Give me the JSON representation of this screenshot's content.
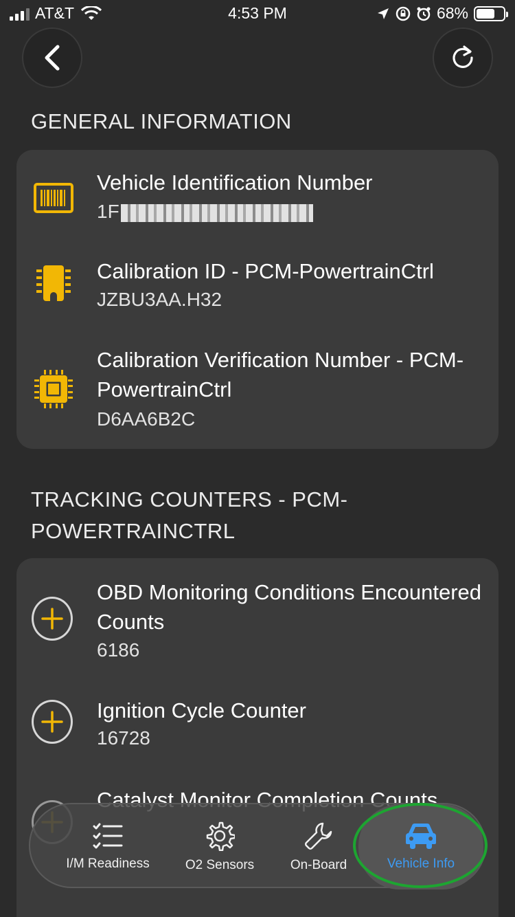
{
  "status_bar": {
    "carrier": "AT&T",
    "time": "4:53 PM",
    "battery": "68%",
    "battery_level": 0.68
  },
  "nav": {
    "back_icon": "chevron-left-icon",
    "refresh_icon": "refresh-icon"
  },
  "general_information": {
    "title": "GENERAL INFORMATION",
    "items": [
      {
        "icon": "barcode-icon",
        "label": "Vehicle Identification Number",
        "value": "1F"
      },
      {
        "icon": "chip-icon",
        "label": "Calibration ID - PCM-PowertrainCtrl",
        "value": "JZBU3AA.H32"
      },
      {
        "icon": "processor-icon",
        "label": "Calibration Verification Number - PCM-PowertrainCtrl",
        "value": "D6AA6B2C"
      }
    ]
  },
  "tracking_counters": {
    "title": "TRACKING COUNTERS - PCM-POWERTRAINCTRL",
    "items": [
      {
        "icon": "plus-circle-icon",
        "label": "OBD Monitoring Conditions Encountered Counts",
        "value": "6186"
      },
      {
        "icon": "plus-circle-icon",
        "label": "Ignition Cycle Counter",
        "value": "16728"
      },
      {
        "icon": "plus-circle-icon",
        "label": "Catalyst Monitor Completion Counts",
        "value": ""
      }
    ]
  },
  "tabbar": {
    "tabs": [
      {
        "label": "I/M Readiness",
        "icon": "checklist-icon"
      },
      {
        "label": "O2 Sensors",
        "icon": "gear-icon"
      },
      {
        "label": "On-Board",
        "icon": "wrench-icon"
      },
      {
        "label": "Vehicle Info",
        "icon": "car-icon",
        "active": true
      }
    ]
  },
  "colors": {
    "accent": "#3d9bf3",
    "icon_yellow": "#f2b705",
    "highlight_green": "#1da531",
    "card_bg": "#3b3b3b",
    "page_bg": "#2b2b2b"
  }
}
